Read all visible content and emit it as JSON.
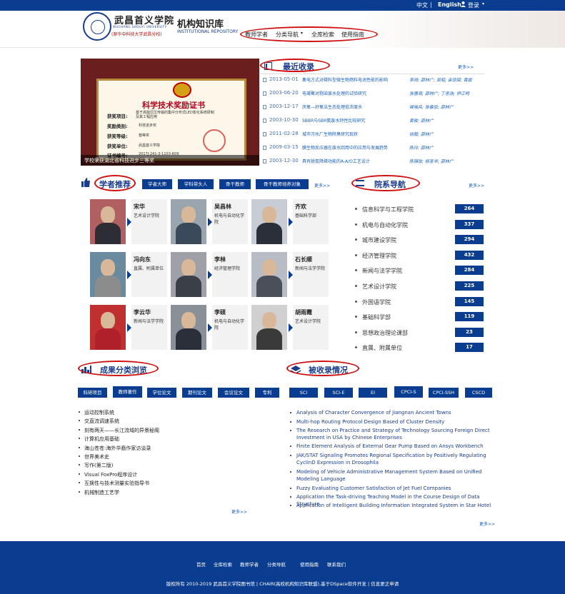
{
  "topbar": {
    "lang_cn": "中文",
    "sep": "|",
    "lang_en": "English",
    "login": "登录"
  },
  "header": {
    "school_cn": "武昌首义学院",
    "school_en": "WUCHANG SHOUYI UNIVERSITY",
    "school_sub": "(原华中科技大学武昌分校)",
    "repo_cn": "机构知识库",
    "repo_en": "INSTITUTIONAL REPOSITORY",
    "nav": [
      "教师学者",
      "分类导航",
      "全库检索",
      "使用指南"
    ]
  },
  "slideshow": {
    "cert_title": "科学技术奖励证书",
    "cert_labels": [
      "获奖项目:",
      "奖励类别:",
      "获奖等级:",
      "获奖单位:",
      "证书编号:"
    ],
    "cert_values": [
      "基于高能压压传输的集中分布式LED变化系统研制及其工程应用",
      "科技进步奖",
      "叁等奖",
      "武昌首义学院",
      "2017J-241-3-1103-R09"
    ],
    "caption": "学校荣获湖北省科技进步三等奖"
  },
  "recent": {
    "title": "最近收录",
    "more": "更多>>",
    "items": [
      {
        "date": "2013-05-01",
        "title": "集电方式对磷料型微生物燃料电池性能的影响",
        "authors": "李琦; 邵林广; 吴昭; 袁琼琛; 黄霞"
      },
      {
        "date": "2003-06-20",
        "title": "电凝聚对剔染废水处理的试验研究",
        "authors": "张惠周; 邵林广; 丁忠浩; 伊江明"
      },
      {
        "date": "2003-12-17",
        "title": "厌氧—好氧法生态处理低浓度水",
        "authors": "侯晓兵; 张春驳; 邵林广"
      },
      {
        "date": "2003-10-30",
        "title": "SBBR与SBR氨废水特性比较研究",
        "authors": "黄俊; 邵林广"
      },
      {
        "date": "2011-02-28",
        "title": "城市污水厂生物除臭研究现状",
        "authors": "徐毅; 邵林广"
      },
      {
        "date": "2009-03-15",
        "title": "膜生物反应器在废水回用中的应用与发展趋势",
        "authors": "陈玲; 邵林广"
      },
      {
        "date": "2003-12-30",
        "title": "具有脱氮降磷功能的A-A/O工艺设计",
        "authors": "陈锦玫; 郝圣华; 邵林广"
      }
    ]
  },
  "scholars": {
    "title": "学者推荐",
    "tabs": [
      "学者大师",
      "学科带头人",
      "骨干教师",
      "骨干教师培养对象"
    ],
    "more": "更多>>",
    "cards": [
      {
        "name": "宋华",
        "dept": "艺术设计学院"
      },
      {
        "name": "吴昌林",
        "dept": "机电与自动化学院"
      },
      {
        "name": "齐欢",
        "dept": "基础科学部"
      },
      {
        "name": "冯向东",
        "dept": "直属、附属单位"
      },
      {
        "name": "李林",
        "dept": "经济管理学院"
      },
      {
        "name": "石长顺",
        "dept": "新闻与法学学院"
      },
      {
        "name": "李云华",
        "dept": "新闻与法学学院"
      },
      {
        "name": "李硕",
        "dept": "机电与自动化学院"
      },
      {
        "name": "胡雨霞",
        "dept": "艺术设计学院"
      }
    ]
  },
  "departments": {
    "title": "院系导航",
    "more": "更多>>",
    "items": [
      {
        "name": "信息科学与工程学院",
        "count": "264"
      },
      {
        "name": "机电与自动化学院",
        "count": "337"
      },
      {
        "name": "城市建设学院",
        "count": "294"
      },
      {
        "name": "经济管理学院",
        "count": "432"
      },
      {
        "name": "新闻与法学学院",
        "count": "284"
      },
      {
        "name": "艺术设计学院",
        "count": "225"
      },
      {
        "name": "外国语学院",
        "count": "145"
      },
      {
        "name": "基础科学部",
        "count": "119"
      },
      {
        "name": "思想政治理论课部",
        "count": "23"
      },
      {
        "name": "直属、附属单位",
        "count": "17"
      }
    ]
  },
  "categories": {
    "title": "成果分类浏览",
    "tabs": [
      "科研项目",
      "教师著作",
      "学位论文",
      "期刊论文",
      "会议论文",
      "专利"
    ],
    "active_tab": 1,
    "items": [
      "运动控制系统",
      "交直流调速系统",
      "刻有两天——长江流域的异景秘阁",
      "计算机应用基础",
      "海山苍苍:海外华裔作家访谈录",
      "世界美术史",
      "写作(第二版)",
      "Visual FoxPro程序设计",
      "互换性与技术测量实验指导书",
      "机械制造工艺学"
    ],
    "more": "更多>>"
  },
  "indexed": {
    "title": "被收录情况",
    "tabs": [
      "SCI",
      "SCI-E",
      "EI",
      "CPCI-S",
      "CPCI-SSH",
      "CSCD"
    ],
    "active_tab": 3,
    "items": [
      "Analysis of Character Convergence of Jiangnan Ancient Towns",
      "Multi-hop Routing Protocol Design Based of Cluster Density",
      "The Research on Practice and Strategy of Technology Sourcing Foreign Direct Investment in USA by Chinese Enterprises",
      "Finite Element Analysis of External Gear Pump Based on Ansys Workbench",
      "JAK/STAT Signaling Promotes Regional Specification by Positively Regulating CyclinD Expression in Drosophila",
      "Modeling of Vehicle Administrative Management System Based on Unified Modeling Language",
      "Fuzzy Evaluating Customer Satisfaction of Jet Fuel Companies",
      "Application the Task-driving Teaching Model in the Course Design of Data Structure",
      "Application of Intelligent Building Information Integrated System in Star Hotel"
    ],
    "more": "更多>>"
  },
  "footer": {
    "links": [
      "首页",
      "全库检索",
      "教师学者",
      "分类导航",
      "使用指南",
      "联系我们"
    ],
    "copyright": "版权所有 2010-2019 武昌首义学院图书馆 | CHAIR(高校机构知识库联盟),基于DSpace软件开发 | 信息更正申请"
  },
  "colors": {
    "primary": "#0a3d8f",
    "annotation": "#d01010",
    "link": "#1a5fb4"
  }
}
